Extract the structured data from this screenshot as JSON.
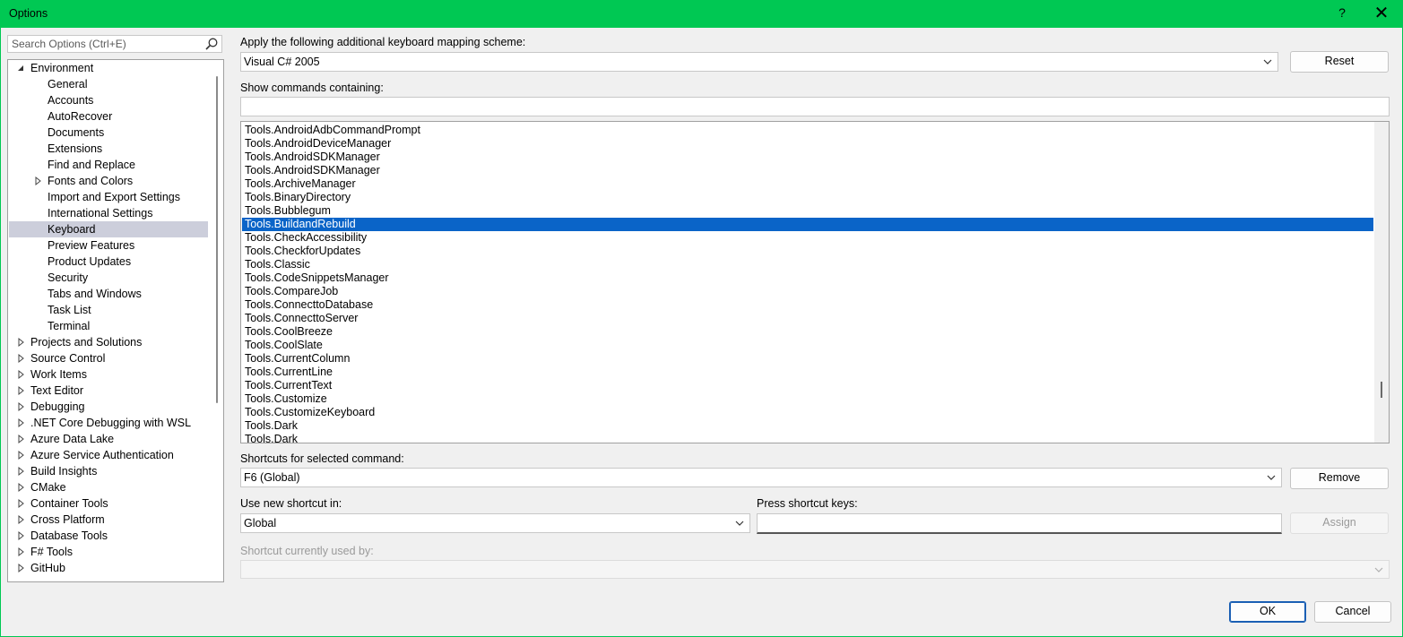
{
  "window": {
    "title": "Options",
    "help_label": "?",
    "close_label": "✕"
  },
  "search": {
    "placeholder": "Search Options (Ctrl+E)",
    "icon": "search-icon"
  },
  "tree": {
    "items": [
      {
        "label": "Environment",
        "level": 0,
        "expander": "expanded"
      },
      {
        "label": "General",
        "level": 1,
        "expander": "none"
      },
      {
        "label": "Accounts",
        "level": 1,
        "expander": "none"
      },
      {
        "label": "AutoRecover",
        "level": 1,
        "expander": "none"
      },
      {
        "label": "Documents",
        "level": 1,
        "expander": "none"
      },
      {
        "label": "Extensions",
        "level": 1,
        "expander": "none"
      },
      {
        "label": "Find and Replace",
        "level": 1,
        "expander": "none"
      },
      {
        "label": "Fonts and Colors",
        "level": 1,
        "expander": "collapsed"
      },
      {
        "label": "Import and Export Settings",
        "level": 1,
        "expander": "none"
      },
      {
        "label": "International Settings",
        "level": 1,
        "expander": "none"
      },
      {
        "label": "Keyboard",
        "level": 1,
        "expander": "none",
        "selected": true
      },
      {
        "label": "Preview Features",
        "level": 1,
        "expander": "none"
      },
      {
        "label": "Product Updates",
        "level": 1,
        "expander": "none"
      },
      {
        "label": "Security",
        "level": 1,
        "expander": "none"
      },
      {
        "label": "Tabs and Windows",
        "level": 1,
        "expander": "none"
      },
      {
        "label": "Task List",
        "level": 1,
        "expander": "none"
      },
      {
        "label": "Terminal",
        "level": 1,
        "expander": "none"
      },
      {
        "label": "Projects and Solutions",
        "level": 0,
        "expander": "collapsed"
      },
      {
        "label": "Source Control",
        "level": 0,
        "expander": "collapsed"
      },
      {
        "label": "Work Items",
        "level": 0,
        "expander": "collapsed"
      },
      {
        "label": "Text Editor",
        "level": 0,
        "expander": "collapsed"
      },
      {
        "label": "Debugging",
        "level": 0,
        "expander": "collapsed"
      },
      {
        "label": ".NET Core Debugging with WSL",
        "level": 0,
        "expander": "collapsed"
      },
      {
        "label": "Azure Data Lake",
        "level": 0,
        "expander": "collapsed"
      },
      {
        "label": "Azure Service Authentication",
        "level": 0,
        "expander": "collapsed"
      },
      {
        "label": "Build Insights",
        "level": 0,
        "expander": "collapsed"
      },
      {
        "label": "CMake",
        "level": 0,
        "expander": "collapsed"
      },
      {
        "label": "Container Tools",
        "level": 0,
        "expander": "collapsed"
      },
      {
        "label": "Cross Platform",
        "level": 0,
        "expander": "collapsed"
      },
      {
        "label": "Database Tools",
        "level": 0,
        "expander": "collapsed"
      },
      {
        "label": "F# Tools",
        "level": 0,
        "expander": "collapsed"
      },
      {
        "label": "GitHub",
        "level": 0,
        "expander": "collapsed"
      }
    ]
  },
  "mapping": {
    "label": "Apply the following additional keyboard mapping scheme:",
    "value": "Visual C# 2005",
    "reset_label": "Reset"
  },
  "show_commands": {
    "label": "Show commands containing:",
    "value": ""
  },
  "commands": {
    "items": [
      "Tools.AndroidAdbCommandPrompt",
      "Tools.AndroidDeviceManager",
      "Tools.AndroidSDKManager",
      "Tools.AndroidSDKManager",
      "Tools.ArchiveManager",
      "Tools.BinaryDirectory",
      "Tools.Bubblegum",
      "Tools.BuildandRebuild",
      "Tools.CheckAccessibility",
      "Tools.CheckforUpdates",
      "Tools.Classic",
      "Tools.CodeSnippetsManager",
      "Tools.CompareJob",
      "Tools.ConnecttoDatabase",
      "Tools.ConnecttoServer",
      "Tools.CoolBreeze",
      "Tools.CoolSlate",
      "Tools.CurrentColumn",
      "Tools.CurrentLine",
      "Tools.CurrentText",
      "Tools.Customize",
      "Tools.CustomizeKeyboard",
      "Tools.Dark",
      "Tools.Dark"
    ],
    "selected_index": 7
  },
  "shortcuts": {
    "label": "Shortcuts for selected command:",
    "value": "F6 (Global)",
    "remove_label": "Remove"
  },
  "use_new": {
    "label": "Use new shortcut in:",
    "value": "Global"
  },
  "press_keys": {
    "label": "Press shortcut keys:",
    "value": "",
    "assign_label": "Assign"
  },
  "used_by": {
    "label": "Shortcut currently used by:",
    "value": ""
  },
  "footer": {
    "ok_label": "OK",
    "cancel_label": "Cancel"
  },
  "colors": {
    "titlebar": "#00c853",
    "selection": "#0a64c8",
    "tree_selection": "#cccedb"
  }
}
